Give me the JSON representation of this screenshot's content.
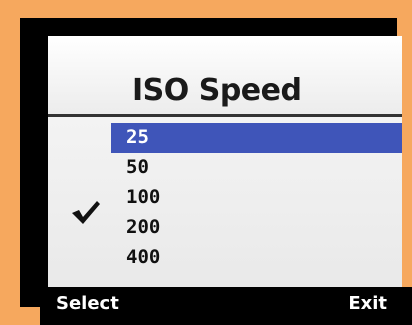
{
  "screen": {
    "title": "ISO Speed"
  },
  "iso_menu": {
    "items": [
      {
        "label": "25",
        "highlighted": true,
        "checked": false
      },
      {
        "label": "50",
        "highlighted": false,
        "checked": false
      },
      {
        "label": "100",
        "highlighted": false,
        "checked": true
      },
      {
        "label": "200",
        "highlighted": false,
        "checked": false
      },
      {
        "label": "400",
        "highlighted": false,
        "checked": false
      }
    ],
    "check_icon": "checkmark-icon"
  },
  "softkeys": {
    "left_label": "Select",
    "right_label": "Exit"
  },
  "colors": {
    "highlight": "#3f55b9",
    "bezel": "#f6a85e"
  }
}
